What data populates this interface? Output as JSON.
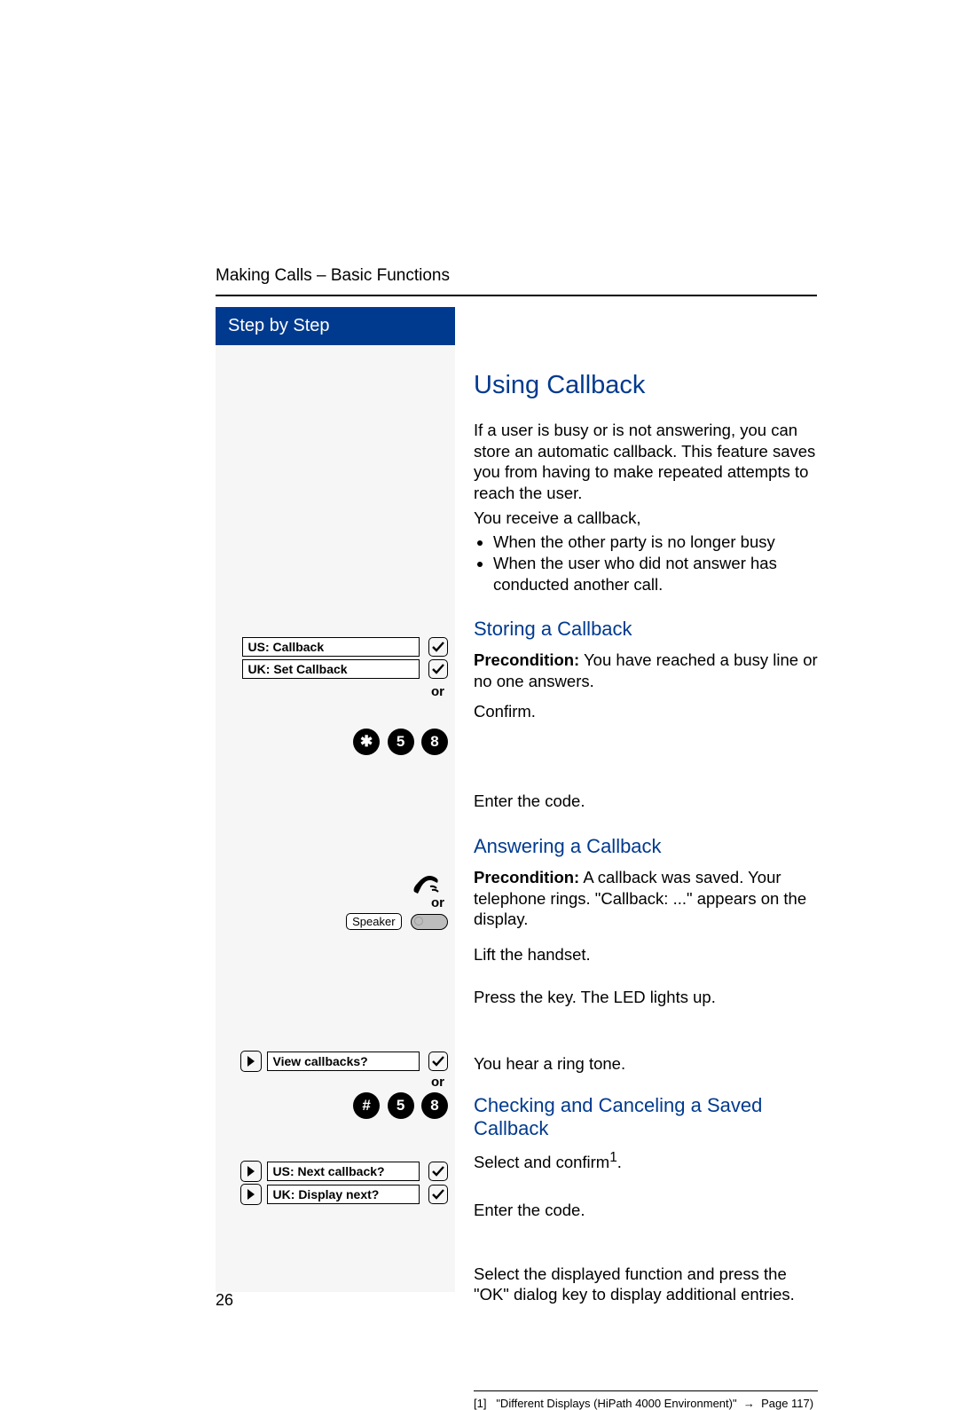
{
  "header": {
    "running": "Making Calls – Basic Functions",
    "step_title": "Step by Step",
    "page_number": "26"
  },
  "sections": {
    "title": "Using Callback",
    "intro_p1": "If a user is busy or is not answering, you can store an automatic callback. This feature saves you from having to make repeated attempts to reach the user.",
    "intro_p2": "You receive a callback,",
    "intro_b1": "When the other party is no longer busy",
    "intro_b2": "When the user who did not answer has conducted another call.",
    "storing": {
      "title": "Storing a Callback",
      "pretext": "Precondition:",
      "pretext_rest": " You have reached a busy line or no one answers.",
      "confirm": "Confirm.",
      "enter_code": "Enter the code."
    },
    "answering": {
      "title": "Answering a Callback",
      "pretext": "Precondition:",
      "pretext_rest": " A callback was saved. Your telephone rings. \"Callback: ...\" appears on the display.",
      "lift": "Lift the handset.",
      "press_key": "Press the key. The LED lights up.",
      "ringtone": "You hear a ring tone."
    },
    "checking": {
      "title": "Checking and Canceling a Saved Callback",
      "select_confirm_pre": "Select and confirm",
      "select_confirm_sup": "1",
      "select_confirm_post": ".",
      "enter_code": "Enter the code.",
      "display_next": "Select the displayed function and press the \"OK\" dialog key to display additional entries."
    },
    "footnote": {
      "num": "[1]",
      "text": "\"Different Displays (HiPath 4000 Environment)\"",
      "arrow": "→",
      "page": "Page 117)"
    }
  },
  "step_col": {
    "us_callback": "US: Callback",
    "uk_set_callback": "UK: Set Callback",
    "or": "or",
    "code_keys_star": [
      "✱",
      "5",
      "8"
    ],
    "speaker": "Speaker",
    "view_callbacks": "View callbacks?",
    "code_keys_hash": [
      "#",
      "5",
      "8"
    ],
    "us_next_callback": "US: Next callback?",
    "uk_display_next": "UK: Display next?"
  }
}
